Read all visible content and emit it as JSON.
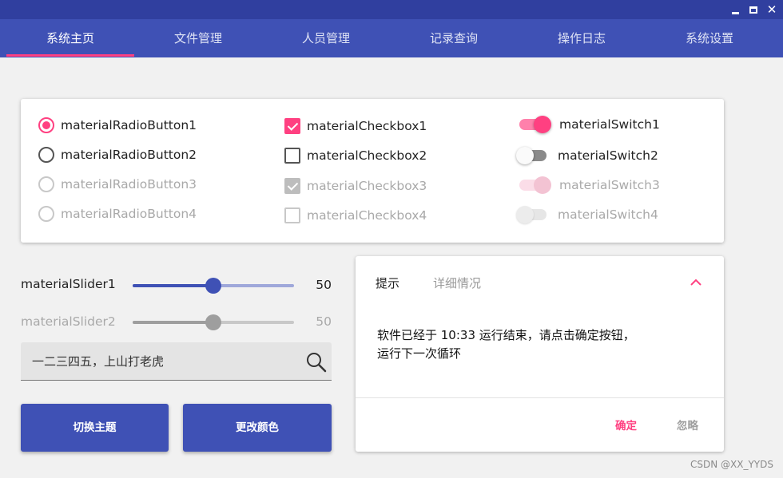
{
  "window": {
    "controls": [
      {
        "name": "minimize-icon"
      },
      {
        "name": "maximize-icon"
      },
      {
        "name": "close-icon",
        "glyph": "✕"
      }
    ]
  },
  "tabs": [
    {
      "label": "系统主页",
      "active": true
    },
    {
      "label": "文件管理",
      "active": false
    },
    {
      "label": "人员管理",
      "active": false
    },
    {
      "label": "记录查询",
      "active": false
    },
    {
      "label": "操作日志",
      "active": false
    },
    {
      "label": "系统设置",
      "active": false
    }
  ],
  "radios": [
    {
      "label": "materialRadioButton1",
      "checked": true,
      "enabled": true
    },
    {
      "label": "materialRadioButton2",
      "checked": false,
      "enabled": true
    },
    {
      "label": "materialRadioButton3",
      "checked": false,
      "enabled": false
    },
    {
      "label": "materialRadioButton4",
      "checked": false,
      "enabled": false
    }
  ],
  "checkboxes": [
    {
      "label": "materialCheckbox1",
      "checked": true,
      "enabled": true
    },
    {
      "label": "materialCheckbox2",
      "checked": false,
      "enabled": true
    },
    {
      "label": "materialCheckbox3",
      "checked": true,
      "enabled": false
    },
    {
      "label": "materialCheckbox4",
      "checked": false,
      "enabled": false
    }
  ],
  "switches": [
    {
      "label": "materialSwitch1",
      "on": true,
      "enabled": true
    },
    {
      "label": "materialSwitch2",
      "on": false,
      "enabled": true
    },
    {
      "label": "materialSwitch3",
      "on": true,
      "enabled": false
    },
    {
      "label": "materialSwitch4",
      "on": false,
      "enabled": false
    }
  ],
  "sliders": [
    {
      "label": "materialSlider1",
      "value": 50,
      "value_text": "50",
      "min": 0,
      "max": 100,
      "enabled": true
    },
    {
      "label": "materialSlider2",
      "value": 50,
      "value_text": "50",
      "min": 0,
      "max": 100,
      "enabled": false
    }
  ],
  "search": {
    "value": "一二三四五，上山打老虎"
  },
  "buttons": {
    "switch_theme": "切换主题",
    "change_color": "更改颜色"
  },
  "panel": {
    "tab_tip": "提示",
    "tab_detail": "详细情况",
    "message_line1": "软件已经于 10:33 运行结束，请点击确定按钮，",
    "message_line2": "运行下一次循环",
    "ok_label": "确定",
    "ignore_label": "忽略"
  },
  "watermark": "CSDN @XX_YYDS",
  "colors": {
    "primary": "#3f51b5",
    "primary_dark": "#303f9f",
    "accent": "#ff4081",
    "background": "#f1f1f1"
  }
}
